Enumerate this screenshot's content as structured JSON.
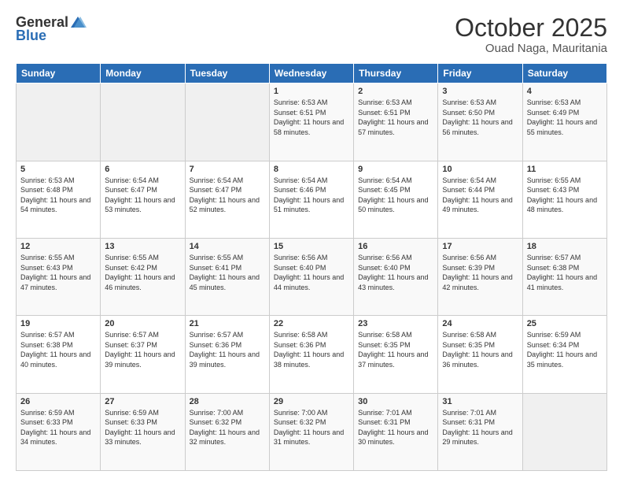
{
  "header": {
    "logo_general": "General",
    "logo_blue": "Blue",
    "month": "October 2025",
    "location": "Ouad Naga, Mauritania"
  },
  "days_of_week": [
    "Sunday",
    "Monday",
    "Tuesday",
    "Wednesday",
    "Thursday",
    "Friday",
    "Saturday"
  ],
  "weeks": [
    [
      {
        "day": "",
        "sunrise": "",
        "sunset": "",
        "daylight": ""
      },
      {
        "day": "",
        "sunrise": "",
        "sunset": "",
        "daylight": ""
      },
      {
        "day": "",
        "sunrise": "",
        "sunset": "",
        "daylight": ""
      },
      {
        "day": "1",
        "sunrise": "Sunrise: 6:53 AM",
        "sunset": "Sunset: 6:51 PM",
        "daylight": "Daylight: 11 hours and 58 minutes."
      },
      {
        "day": "2",
        "sunrise": "Sunrise: 6:53 AM",
        "sunset": "Sunset: 6:51 PM",
        "daylight": "Daylight: 11 hours and 57 minutes."
      },
      {
        "day": "3",
        "sunrise": "Sunrise: 6:53 AM",
        "sunset": "Sunset: 6:50 PM",
        "daylight": "Daylight: 11 hours and 56 minutes."
      },
      {
        "day": "4",
        "sunrise": "Sunrise: 6:53 AM",
        "sunset": "Sunset: 6:49 PM",
        "daylight": "Daylight: 11 hours and 55 minutes."
      }
    ],
    [
      {
        "day": "5",
        "sunrise": "Sunrise: 6:53 AM",
        "sunset": "Sunset: 6:48 PM",
        "daylight": "Daylight: 11 hours and 54 minutes."
      },
      {
        "day": "6",
        "sunrise": "Sunrise: 6:54 AM",
        "sunset": "Sunset: 6:47 PM",
        "daylight": "Daylight: 11 hours and 53 minutes."
      },
      {
        "day": "7",
        "sunrise": "Sunrise: 6:54 AM",
        "sunset": "Sunset: 6:47 PM",
        "daylight": "Daylight: 11 hours and 52 minutes."
      },
      {
        "day": "8",
        "sunrise": "Sunrise: 6:54 AM",
        "sunset": "Sunset: 6:46 PM",
        "daylight": "Daylight: 11 hours and 51 minutes."
      },
      {
        "day": "9",
        "sunrise": "Sunrise: 6:54 AM",
        "sunset": "Sunset: 6:45 PM",
        "daylight": "Daylight: 11 hours and 50 minutes."
      },
      {
        "day": "10",
        "sunrise": "Sunrise: 6:54 AM",
        "sunset": "Sunset: 6:44 PM",
        "daylight": "Daylight: 11 hours and 49 minutes."
      },
      {
        "day": "11",
        "sunrise": "Sunrise: 6:55 AM",
        "sunset": "Sunset: 6:43 PM",
        "daylight": "Daylight: 11 hours and 48 minutes."
      }
    ],
    [
      {
        "day": "12",
        "sunrise": "Sunrise: 6:55 AM",
        "sunset": "Sunset: 6:43 PM",
        "daylight": "Daylight: 11 hours and 47 minutes."
      },
      {
        "day": "13",
        "sunrise": "Sunrise: 6:55 AM",
        "sunset": "Sunset: 6:42 PM",
        "daylight": "Daylight: 11 hours and 46 minutes."
      },
      {
        "day": "14",
        "sunrise": "Sunrise: 6:55 AM",
        "sunset": "Sunset: 6:41 PM",
        "daylight": "Daylight: 11 hours and 45 minutes."
      },
      {
        "day": "15",
        "sunrise": "Sunrise: 6:56 AM",
        "sunset": "Sunset: 6:40 PM",
        "daylight": "Daylight: 11 hours and 44 minutes."
      },
      {
        "day": "16",
        "sunrise": "Sunrise: 6:56 AM",
        "sunset": "Sunset: 6:40 PM",
        "daylight": "Daylight: 11 hours and 43 minutes."
      },
      {
        "day": "17",
        "sunrise": "Sunrise: 6:56 AM",
        "sunset": "Sunset: 6:39 PM",
        "daylight": "Daylight: 11 hours and 42 minutes."
      },
      {
        "day": "18",
        "sunrise": "Sunrise: 6:57 AM",
        "sunset": "Sunset: 6:38 PM",
        "daylight": "Daylight: 11 hours and 41 minutes."
      }
    ],
    [
      {
        "day": "19",
        "sunrise": "Sunrise: 6:57 AM",
        "sunset": "Sunset: 6:38 PM",
        "daylight": "Daylight: 11 hours and 40 minutes."
      },
      {
        "day": "20",
        "sunrise": "Sunrise: 6:57 AM",
        "sunset": "Sunset: 6:37 PM",
        "daylight": "Daylight: 11 hours and 39 minutes."
      },
      {
        "day": "21",
        "sunrise": "Sunrise: 6:57 AM",
        "sunset": "Sunset: 6:36 PM",
        "daylight": "Daylight: 11 hours and 39 minutes."
      },
      {
        "day": "22",
        "sunrise": "Sunrise: 6:58 AM",
        "sunset": "Sunset: 6:36 PM",
        "daylight": "Daylight: 11 hours and 38 minutes."
      },
      {
        "day": "23",
        "sunrise": "Sunrise: 6:58 AM",
        "sunset": "Sunset: 6:35 PM",
        "daylight": "Daylight: 11 hours and 37 minutes."
      },
      {
        "day": "24",
        "sunrise": "Sunrise: 6:58 AM",
        "sunset": "Sunset: 6:35 PM",
        "daylight": "Daylight: 11 hours and 36 minutes."
      },
      {
        "day": "25",
        "sunrise": "Sunrise: 6:59 AM",
        "sunset": "Sunset: 6:34 PM",
        "daylight": "Daylight: 11 hours and 35 minutes."
      }
    ],
    [
      {
        "day": "26",
        "sunrise": "Sunrise: 6:59 AM",
        "sunset": "Sunset: 6:33 PM",
        "daylight": "Daylight: 11 hours and 34 minutes."
      },
      {
        "day": "27",
        "sunrise": "Sunrise: 6:59 AM",
        "sunset": "Sunset: 6:33 PM",
        "daylight": "Daylight: 11 hours and 33 minutes."
      },
      {
        "day": "28",
        "sunrise": "Sunrise: 7:00 AM",
        "sunset": "Sunset: 6:32 PM",
        "daylight": "Daylight: 11 hours and 32 minutes."
      },
      {
        "day": "29",
        "sunrise": "Sunrise: 7:00 AM",
        "sunset": "Sunset: 6:32 PM",
        "daylight": "Daylight: 11 hours and 31 minutes."
      },
      {
        "day": "30",
        "sunrise": "Sunrise: 7:01 AM",
        "sunset": "Sunset: 6:31 PM",
        "daylight": "Daylight: 11 hours and 30 minutes."
      },
      {
        "day": "31",
        "sunrise": "Sunrise: 7:01 AM",
        "sunset": "Sunset: 6:31 PM",
        "daylight": "Daylight: 11 hours and 29 minutes."
      },
      {
        "day": "",
        "sunrise": "",
        "sunset": "",
        "daylight": ""
      }
    ]
  ]
}
